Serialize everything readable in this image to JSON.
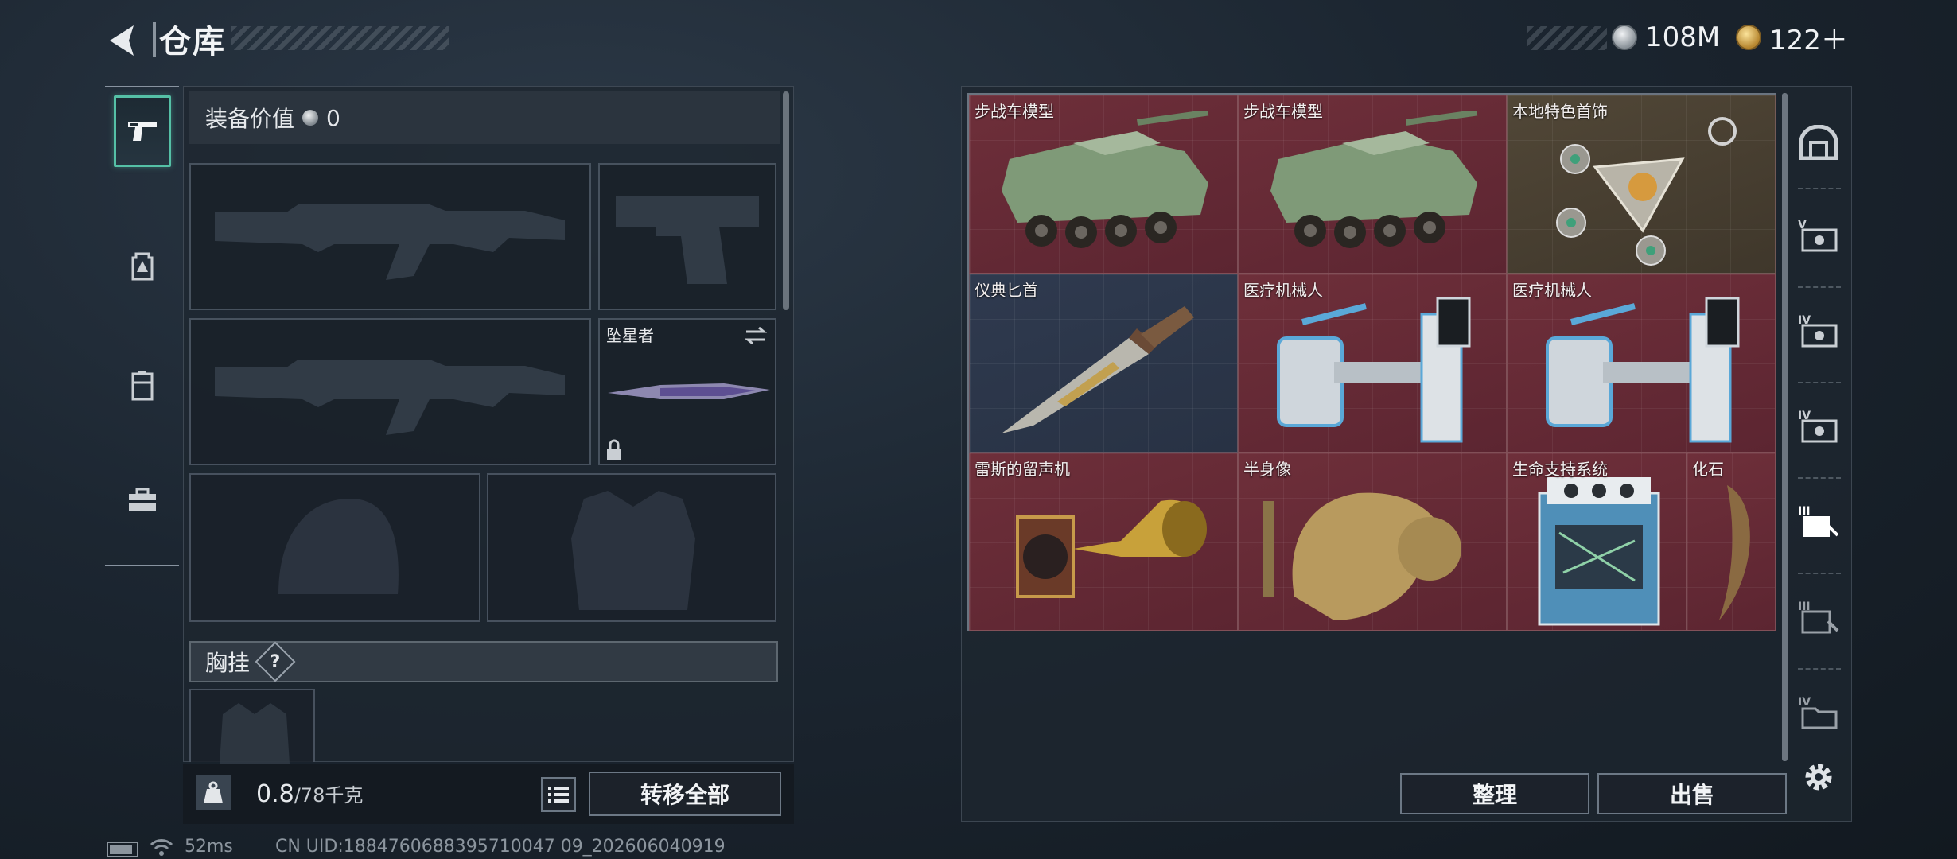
{
  "header": {
    "title": "仓库",
    "back_icon": "back-arrow-icon"
  },
  "currency": [
    {
      "icon": "silver-coin-icon",
      "value": "108M",
      "color": "#c0c6cc"
    },
    {
      "icon": "gold-coin-icon",
      "value": "122＋",
      "color": "#d9b25a"
    }
  ],
  "left_rail": [
    {
      "icon": "pistol-icon",
      "active": true
    },
    {
      "icon": "backpack-icon",
      "active": false
    },
    {
      "icon": "locker-icon",
      "active": false
    },
    {
      "icon": "toolbox-icon",
      "active": false
    }
  ],
  "loadout": {
    "value_label": "装备价值",
    "value": "0",
    "melee_label": "坠星者",
    "vest_label": "胸挂",
    "help": "?",
    "weight_current": "0.8",
    "weight_max": "/78千克",
    "transfer_all": "转移全部"
  },
  "storage": {
    "items": [
      {
        "name": "步战车模型",
        "rarity": "red"
      },
      {
        "name": "步战车模型",
        "rarity": "red"
      },
      {
        "name": "本地特色首饰",
        "rarity": "gold"
      },
      {
        "name": "仪典匕首",
        "rarity": "blue"
      },
      {
        "name": "医疗机械人",
        "rarity": "red"
      },
      {
        "name": "医疗机械人",
        "rarity": "red"
      },
      {
        "name": "雷斯的留声机",
        "rarity": "red"
      },
      {
        "name": "半身像",
        "rarity": "red"
      },
      {
        "name": "生命支持系统",
        "rarity": "red"
      },
      {
        "name": "化石",
        "rarity": "red"
      }
    ],
    "sort_button": "整理",
    "sell_button": "出售"
  },
  "right_tabs": [
    "helmet-tab-icon",
    "case-v-icon",
    "case-iv-icon",
    "case-iv-icon",
    "case-iii-icon",
    "case-iii-icon",
    "case-iv-folder-icon"
  ],
  "status_bar": {
    "ping": "52ms",
    "uid": "CN UID:1884760688395710047 09_202606040919"
  },
  "colors": {
    "accent": "#55c0a6",
    "red_rarity": "#6e2f3a",
    "gold_rarity": "#514737",
    "blue_rarity": "#2f3a4f"
  }
}
